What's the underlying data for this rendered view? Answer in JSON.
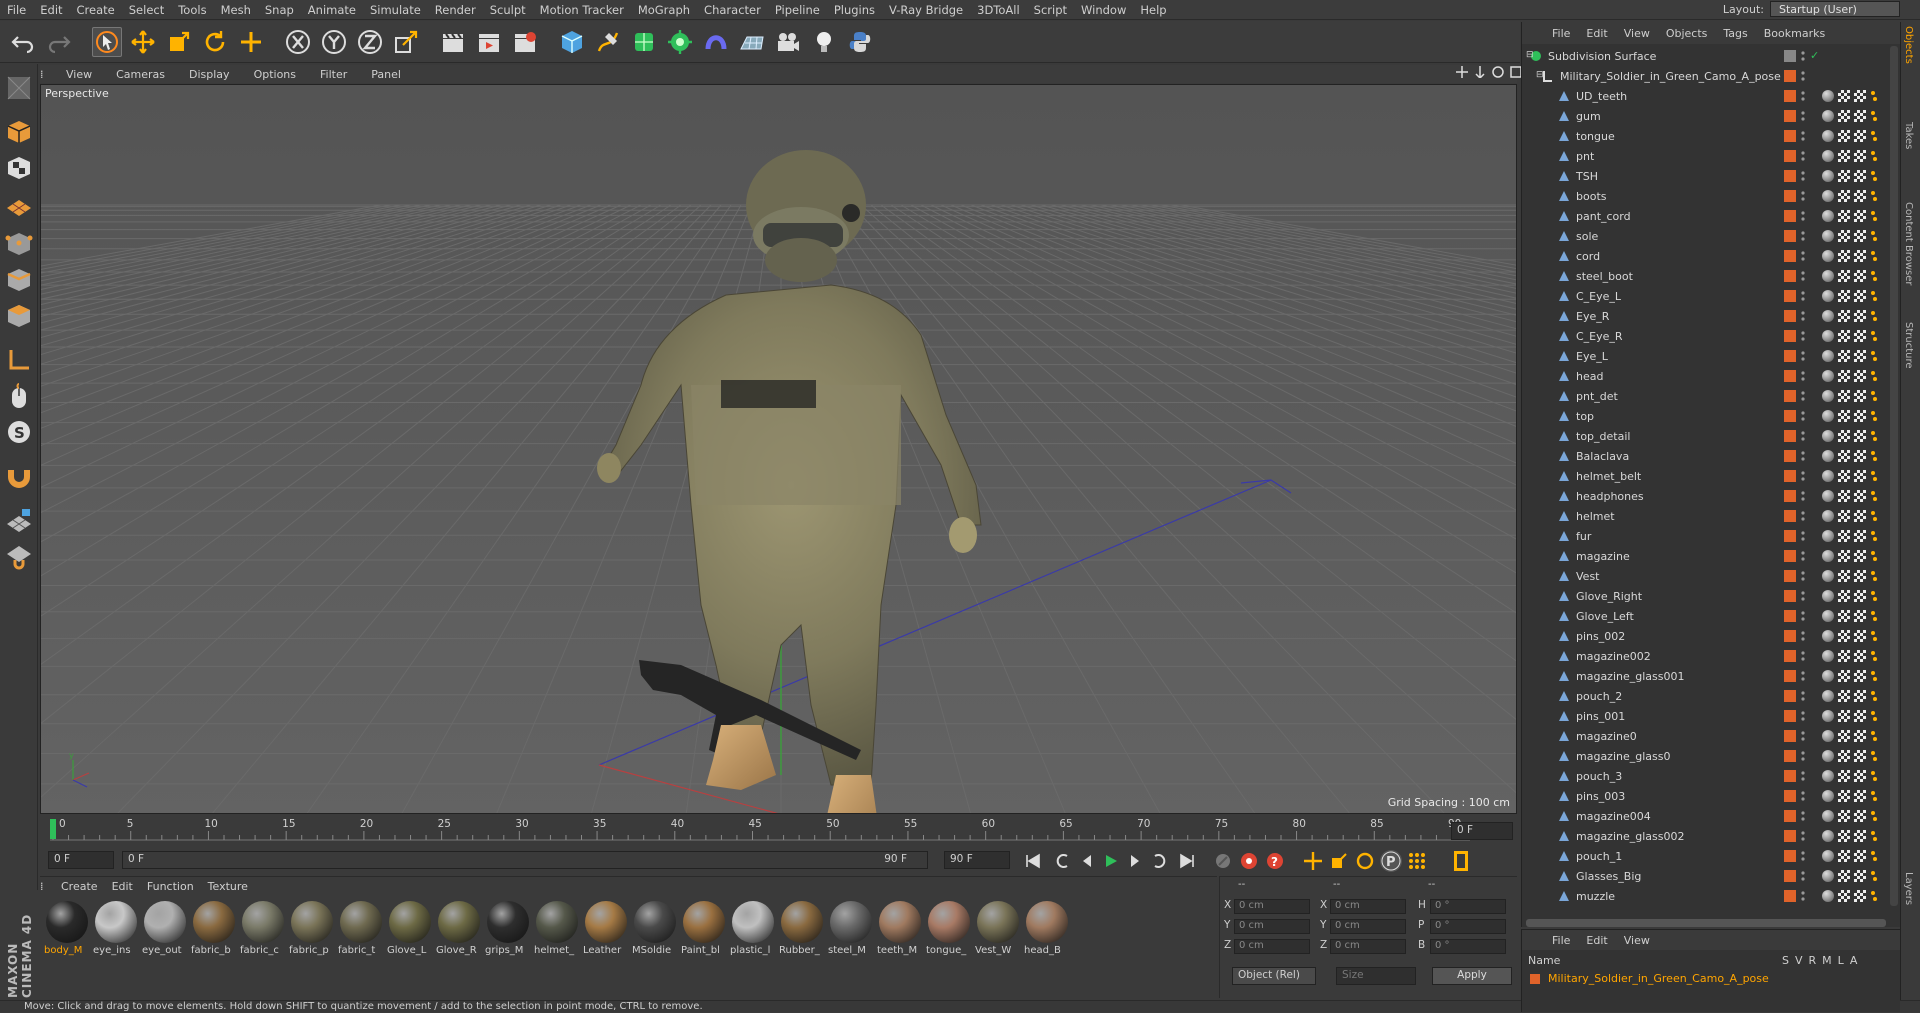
{
  "menu": [
    "File",
    "Edit",
    "Create",
    "Select",
    "Tools",
    "Mesh",
    "Snap",
    "Animate",
    "Simulate",
    "Render",
    "Sculpt",
    "Motion Tracker",
    "MoGraph",
    "Character",
    "Pipeline",
    "Plugins",
    "V-Ray Bridge",
    "3DToAll",
    "Script",
    "Window",
    "Help"
  ],
  "layout": {
    "label": "Layout:",
    "value": "Startup (User)"
  },
  "viewport": {
    "menu": [
      "View",
      "Cameras",
      "Display",
      "Options",
      "Filter",
      "Panel"
    ],
    "label": "Perspective",
    "grid_spacing": "Grid Spacing : 100 cm"
  },
  "timeline": {
    "ticks": [
      "0",
      "5",
      "10",
      "15",
      "20",
      "25",
      "30",
      "35",
      "40",
      "45",
      "50",
      "55",
      "60",
      "65",
      "70",
      "75",
      "80",
      "85",
      "90"
    ],
    "end_frame": "0 F",
    "current": "0 F",
    "range_start": "0 F",
    "range_end": "90 F",
    "max": "90 F"
  },
  "materials": {
    "menu": [
      "Create",
      "Edit",
      "Function",
      "Texture"
    ],
    "items": [
      {
        "name": "body_M",
        "color": "#2a2a2a",
        "hl": true
      },
      {
        "name": "eye_ins",
        "color": "#c8c8c8"
      },
      {
        "name": "eye_out",
        "color": "#b0b0b0"
      },
      {
        "name": "fabric_b",
        "color": "#8a6a40"
      },
      {
        "name": "fabric_c",
        "color": "#7a7a68"
      },
      {
        "name": "fabric_p",
        "color": "#7a7458"
      },
      {
        "name": "fabric_t",
        "color": "#6f6a50"
      },
      {
        "name": "Glove_L",
        "color": "#6d6a45"
      },
      {
        "name": "Glove_R",
        "color": "#6d6a45"
      },
      {
        "name": "grips_M",
        "color": "#2e2e2e"
      },
      {
        "name": "helmet_",
        "color": "#55584a"
      },
      {
        "name": "Leather",
        "color": "#a57a45"
      },
      {
        "name": "MSoldie",
        "color": "#4a4a4a"
      },
      {
        "name": "Paint_bl",
        "color": "#9a7040"
      },
      {
        "name": "plastic_l",
        "color": "#c0c0c0"
      },
      {
        "name": "Rubber_",
        "color": "#8a6a40"
      },
      {
        "name": "steel_M",
        "color": "#6a6a6a"
      },
      {
        "name": "teeth_M",
        "color": "#a07a60"
      },
      {
        "name": "tongue_",
        "color": "#a87a65"
      },
      {
        "name": "Vest_W",
        "color": "#7a7458"
      },
      {
        "name": "head_B",
        "color": "#a07a60"
      }
    ]
  },
  "coords": {
    "header": [
      "--",
      "--",
      "--"
    ],
    "rows": [
      {
        "a": "X",
        "av": "0 cm",
        "b": "X",
        "bv": "0 cm",
        "c": "H",
        "cv": "0 °"
      },
      {
        "a": "Y",
        "av": "0 cm",
        "b": "Y",
        "bv": "0 cm",
        "c": "P",
        "cv": "0 °"
      },
      {
        "a": "Z",
        "av": "0 cm",
        "b": "Z",
        "bv": "0 cm",
        "c": "B",
        "cv": "0 °"
      }
    ],
    "mode": "Object (Rel)",
    "size": "Size",
    "apply": "Apply"
  },
  "objects": {
    "menu": [
      "File",
      "Edit",
      "View",
      "Objects",
      "Tags",
      "Bookmarks"
    ],
    "root": "Subdivision Surface",
    "group": "Military_Soldier_in_Green_Camo_A_pose",
    "children": [
      "UD_teeth",
      "gum",
      "tongue",
      "pnt",
      "TSH",
      "boots",
      "pant_cord",
      "sole",
      "cord",
      "steel_boot",
      "C_Eye_L",
      "Eye_R",
      "C_Eye_R",
      "Eye_L",
      "head",
      "pnt_det",
      "top",
      "top_detail",
      "Balaclava",
      "helmet_belt",
      "headphones",
      "helmet",
      "fur",
      "magazine",
      "Vest",
      "Glove_Right",
      "Glove_Left",
      "pins_002",
      "magazine002",
      "magazine_glass001",
      "pouch_2",
      "pins_001",
      "magazine0",
      "magazine_glass0",
      "pouch_3",
      "pins_003",
      "magazine004",
      "magazine_glass002",
      "pouch_1",
      "Glasses_Big",
      "muzzle"
    ]
  },
  "attributes": {
    "menu": [
      "File",
      "Edit",
      "View"
    ],
    "col_name": "Name",
    "cols": [
      "S",
      "V",
      "R",
      "M",
      "L",
      "A"
    ],
    "row": "Military_Soldier_in_Green_Camo_A_pose"
  },
  "right_tabs": [
    "Objects",
    "Takes",
    "Content Browser",
    "Structure",
    "Layers"
  ],
  "brand": "MAXON CINEMA 4D",
  "status": "Move: Click and drag to move elements. Hold down SHIFT to quantize movement / add to the selection in point mode, CTRL to remove.",
  "colors": {
    "accent": "#ffa500",
    "viewport": "#5b5b5b",
    "panel": "#3a3a3a"
  }
}
